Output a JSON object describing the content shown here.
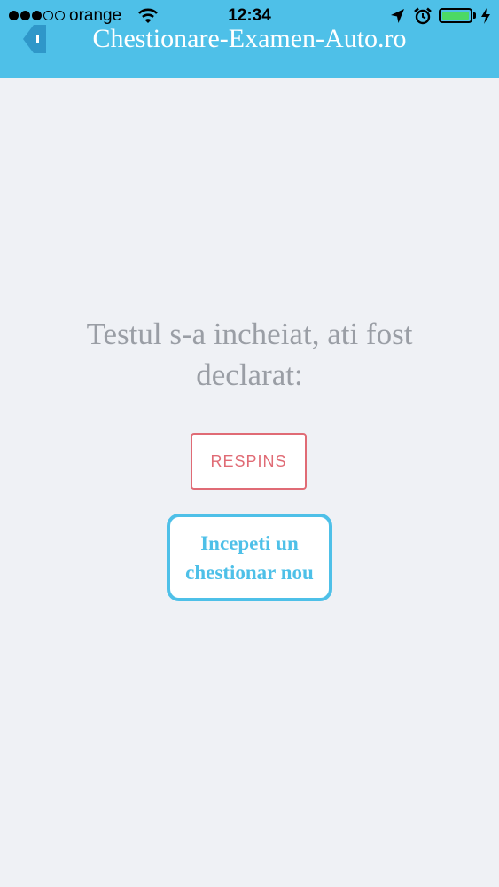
{
  "status_bar": {
    "carrier": "orange",
    "time": "12:34",
    "signal_bars": 3,
    "signal_total": 5,
    "battery_level": 1.0
  },
  "header": {
    "title": "Chestionare-Examen-Auto.ro",
    "back_icon": "back-arrow-icon",
    "background_color": "#4ec0e8"
  },
  "main": {
    "message": "Testul s-a incheiat, ati fost declarat:",
    "result": "RESPINS",
    "result_color": "#e06b75",
    "new_quiz_label": "Incepeti un chestionar nou"
  }
}
